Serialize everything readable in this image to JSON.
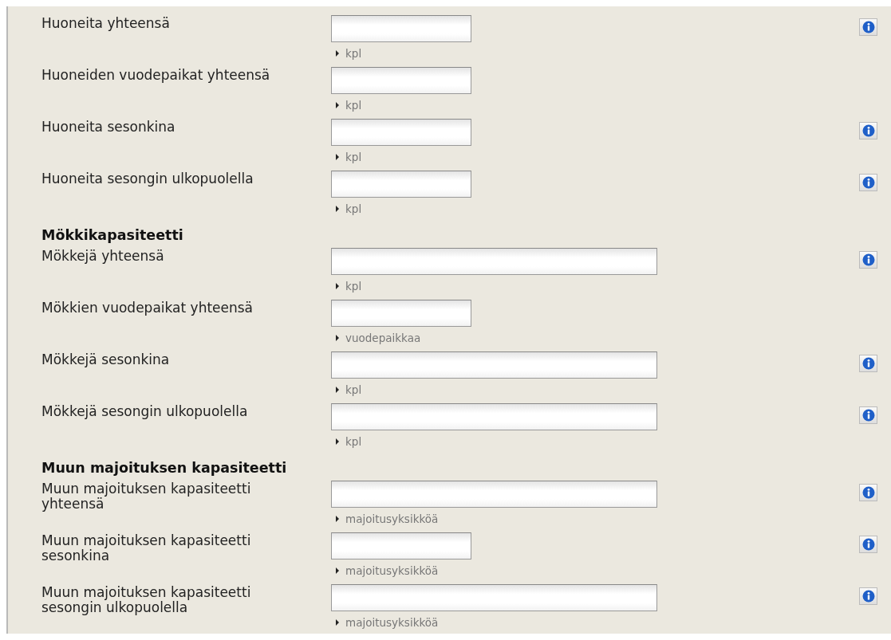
{
  "sections": [
    {
      "fields": [
        {
          "label": "Huoneita yhteensä",
          "kind": "short",
          "unit": "kpl",
          "info": true
        },
        {
          "label": "Huoneiden vuodepaikat yhteensä",
          "kind": "short",
          "unit": "kpl",
          "info": false
        },
        {
          "label": "Huoneita sesonkina",
          "kind": "short",
          "unit": "kpl",
          "info": true
        },
        {
          "label": "Huoneita sesongin ulkopuolella",
          "kind": "short",
          "unit": "kpl",
          "info": true
        }
      ]
    },
    {
      "heading": "Mökkikapasiteetti",
      "fields": [
        {
          "label": "Mökkejä yhteensä",
          "kind": "long",
          "unit": "kpl",
          "info": true
        },
        {
          "label": "Mökkien vuodepaikat yhteensä",
          "kind": "short",
          "unit": "vuodepaikkaa",
          "info": false
        },
        {
          "label": "Mökkejä sesonkina",
          "kind": "long",
          "unit": "kpl",
          "info": true
        },
        {
          "label": "Mökkejä sesongin ulkopuolella",
          "kind": "long",
          "unit": "kpl",
          "info": true
        }
      ]
    },
    {
      "heading": "Muun majoituksen kapasiteetti",
      "fields": [
        {
          "label": "Muun majoituksen kapasiteetti yhteensä",
          "kind": "long",
          "unit": "majoitusyksikköä",
          "info": true
        },
        {
          "label": "Muun majoituksen kapasiteetti sesonkina",
          "kind": "short",
          "unit": "majoitusyksikköä",
          "info": true
        },
        {
          "label": "Muun majoituksen kapasiteetti sesongin ulkopuolella",
          "kind": "long",
          "unit": "majoitusyksikköä",
          "info": true
        }
      ]
    }
  ]
}
